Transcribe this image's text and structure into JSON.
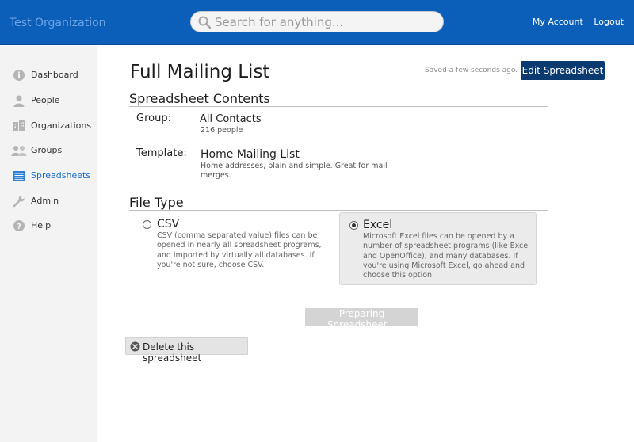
{
  "header": {
    "org_name": "Test Organization",
    "search_placeholder": "Search for anything...",
    "links": {
      "account": "My Account",
      "logout": "Logout"
    }
  },
  "sidebar": {
    "items": [
      {
        "label": "Dashboard",
        "icon": "info-icon"
      },
      {
        "label": "People",
        "icon": "person-icon"
      },
      {
        "label": "Organizations",
        "icon": "building-icon"
      },
      {
        "label": "Groups",
        "icon": "group-icon"
      },
      {
        "label": "Spreadsheets",
        "icon": "spreadsheet-icon",
        "active": true
      },
      {
        "label": "Admin",
        "icon": "wrench-icon"
      },
      {
        "label": "Help",
        "icon": "help-icon"
      }
    ]
  },
  "main": {
    "title": "Full Mailing List",
    "saved_status": "Saved a few seconds ago.",
    "edit_button": "Edit Spreadsheet",
    "contents_title": "Spreadsheet Contents",
    "group": {
      "label": "Group:",
      "value": "All Contacts",
      "sub": "216 people"
    },
    "template": {
      "label": "Template:",
      "value": "Home Mailing List",
      "sub": "Home addresses, plain and simple. Great for mail merges."
    },
    "file_type_title": "File Type",
    "options": [
      {
        "name": "CSV",
        "selected": false,
        "desc": "CSV (comma separated value) files can be opened in nearly all spreadsheet programs, and imported by virtually all databases. If you're not sure, choose CSV."
      },
      {
        "name": "Excel",
        "selected": true,
        "desc": "Microsoft Excel files can be opened by a number of spreadsheet programs (like Excel and OpenOffice), and many databases. If you're using Microsoft Excel, go ahead and choose this option."
      }
    ],
    "preparing_button": "Preparing Spreadsheet...",
    "delete_button": "Delete this spreadsheet"
  },
  "colors": {
    "header": "#0b5fb8",
    "accent": "#1a6dc6",
    "edit_button": "#0a3a70"
  }
}
